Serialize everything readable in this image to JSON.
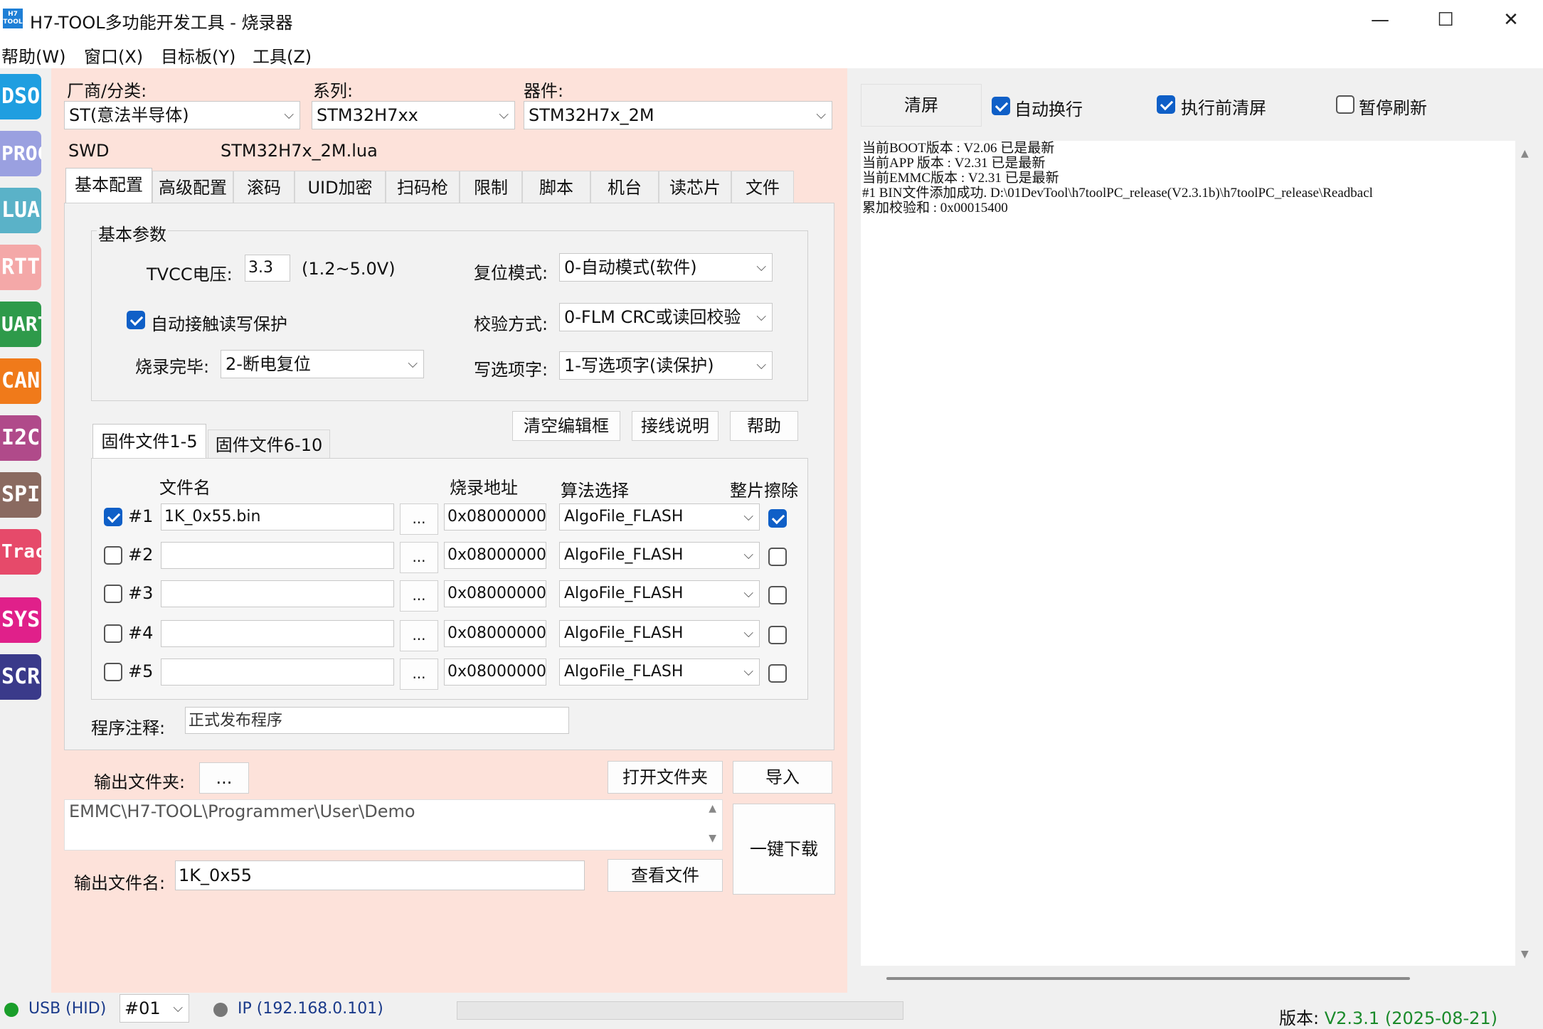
{
  "window": {
    "icon_text": "H7\nTOOL",
    "title": "H7-TOOL多功能开发工具 - 烧录器",
    "minimize": "—",
    "maximize": "☐",
    "close": "✕"
  },
  "menu": [
    "帮助(W)",
    "窗口(X)",
    "目标板(Y)",
    "工具(Z)"
  ],
  "sidebar": [
    {
      "label": "DSO",
      "color": "#1f9ee0"
    },
    {
      "label": "PROG",
      "color": "#9aa0e0"
    },
    {
      "label": "LUA",
      "color": "#5ab2c8"
    },
    {
      "label": "RTT",
      "color": "#f4a8a8"
    },
    {
      "label": "UART",
      "color": "#2e9a4a"
    },
    {
      "label": "CAN",
      "color": "#f07a1a"
    },
    {
      "label": "I2C",
      "color": "#b04a8a"
    },
    {
      "label": "SPI",
      "color": "#8a6a60"
    },
    {
      "label": "Trace",
      "color": "#e64a6a"
    },
    {
      "label": "SYS",
      "color": "#e0208a"
    },
    {
      "label": "SCR",
      "color": "#3a3a8a"
    }
  ],
  "selectors": {
    "vendor_label": "厂商/分类:",
    "vendor_value": "ST(意法半导体)",
    "series_label": "系列:",
    "series_value": "STM32H7xx",
    "device_label": "器件:",
    "device_value": "STM32H7x_2M",
    "interface": "SWD",
    "lua_file": "STM32H7x_2M.lua"
  },
  "tabs": [
    "基本配置",
    "高级配置",
    "滚码",
    "UID加密",
    "扫码枪",
    "限制",
    "脚本",
    "机台",
    "读芯片",
    "文件"
  ],
  "basic": {
    "group_title": "基本参数",
    "tvcc_label": "TVCC电压:",
    "tvcc_value": "3.3",
    "tvcc_range": "(1.2~5.0V)",
    "reset_label": "复位模式:",
    "reset_value": "0-自动模式(软件)",
    "auto_protect_label": "自动接触读写保护",
    "auto_protect_checked": true,
    "verify_label": "校验方式:",
    "verify_value": "0-FLM CRC或读回校验",
    "done_label": "烧录完毕:",
    "done_value": "2-断电复位",
    "option_label": "写选项字:",
    "option_value": "1-写选项字(读保护)"
  },
  "actions": {
    "clear_edit": "清空编辑框",
    "wiring": "接线说明",
    "help": "帮助"
  },
  "fw_tabs": [
    "固件文件1-5",
    "固件文件6-10"
  ],
  "fw_headers": {
    "file": "文件名",
    "addr": "烧录地址",
    "algo": "算法选择",
    "erase": "整片擦除"
  },
  "fw_rows": [
    {
      "id": "#1",
      "checked": true,
      "file": "1K_0x55.bin",
      "browse": "...",
      "addr": "0x08000000",
      "algo": "AlgoFile_FLASH",
      "erase": true
    },
    {
      "id": "#2",
      "checked": false,
      "file": "",
      "browse": "...",
      "addr": "0x08000000",
      "algo": "AlgoFile_FLASH",
      "erase": false
    },
    {
      "id": "#3",
      "checked": false,
      "file": "",
      "browse": "...",
      "addr": "0x08000000",
      "algo": "AlgoFile_FLASH",
      "erase": false
    },
    {
      "id": "#4",
      "checked": false,
      "file": "",
      "browse": "...",
      "addr": "0x08000000",
      "algo": "AlgoFile_FLASH",
      "erase": false
    },
    {
      "id": "#5",
      "checked": false,
      "file": "",
      "browse": "...",
      "addr": "0x08000000",
      "algo": "AlgoFile_FLASH",
      "erase": false
    }
  ],
  "note": {
    "label": "程序注释:",
    "value": "正式发布程序"
  },
  "output": {
    "folder_label": "输出文件夹:",
    "folder_browse": "...",
    "open_folder": "打开文件夹",
    "import": "导入",
    "folder_path": "EMMC\\H7-TOOL\\Programmer\\User\\Demo",
    "download": "一键下载",
    "file_label": "输出文件名:",
    "file_value": "1K_0x55",
    "view_file": "查看文件"
  },
  "log_panel": {
    "clear": "清屏",
    "auto_wrap": "自动换行",
    "auto_wrap_checked": true,
    "clear_before": "执行前清屏",
    "clear_before_checked": true,
    "pause": "暂停刷新",
    "pause_checked": false,
    "lines": [
      "当前BOOT版本 : V2.06 已是最新",
      "当前APP 版本 : V2.31 已是最新",
      "当前EMMC版本 : V2.31 已是最新",
      "#1 BIN文件添加成功. D:\\01DevTool\\h7toolPC_release(V2.3.1b)\\h7toolPC_release\\Readbacl",
      "累加校验和 : 0x00015400"
    ]
  },
  "status": {
    "usb": "USB (HID)",
    "usb_color": "#1a9e2a",
    "device_no": "#01",
    "ip": "IP (192.168.0.101)",
    "ip_color": "#777777",
    "version_label": "版本: ",
    "version_value": "V2.3.1 (2025-08-21)",
    "version_color": "#1a8a2a"
  }
}
